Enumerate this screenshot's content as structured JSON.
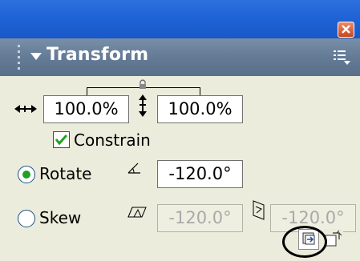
{
  "panel": {
    "title": "Transform",
    "close_icon": "close-icon",
    "menu_icon": "options-menu-icon"
  },
  "scale": {
    "width_value": "100.0%",
    "height_value": "100.0%",
    "constrain_label": "Constrain",
    "constrain_checked": true
  },
  "rotate": {
    "label": "Rotate",
    "selected": true,
    "value": "-120.0°"
  },
  "skew": {
    "label": "Skew",
    "selected": false,
    "horizontal_value": "-120.0°",
    "vertical_value": "-120.0°"
  },
  "colors": {
    "titlebar": "#2467d9",
    "header": "#687f99",
    "panel_bg": "#ececdc",
    "check_green": "#21a121"
  }
}
